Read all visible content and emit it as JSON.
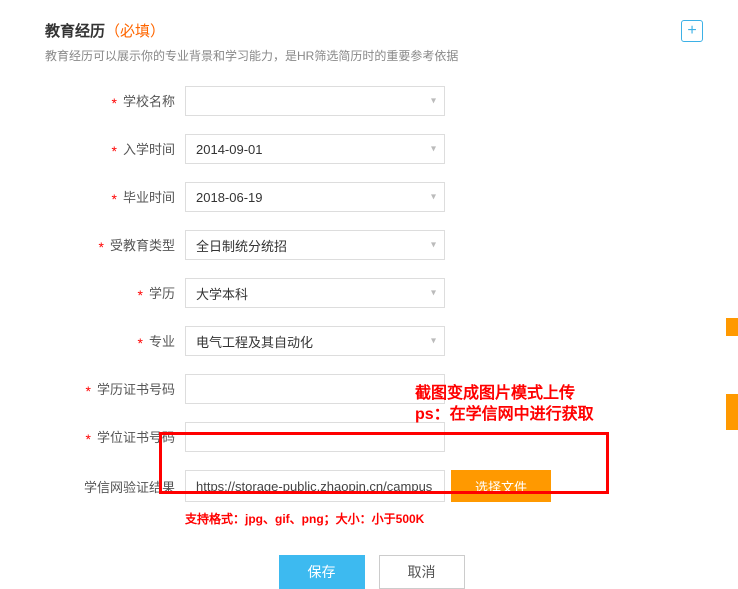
{
  "header": {
    "title": "教育经历",
    "required_tag": "（必填）",
    "subtitle": "教育经历可以展示你的专业背景和学习能力，是HR筛选简历时的重要参考依据",
    "add_label": "+"
  },
  "fields": {
    "school": {
      "label": "学校名称",
      "value": ""
    },
    "enroll": {
      "label": "入学时间",
      "value": "2014-09-01"
    },
    "grad": {
      "label": "毕业时间",
      "value": "2018-06-19"
    },
    "edu_type": {
      "label": "受教育类型",
      "value": "全日制统分统招"
    },
    "degree": {
      "label": "学历",
      "value": "大学本科"
    },
    "major": {
      "label": "专业",
      "value": "电气工程及其自动化"
    },
    "cert_degree": {
      "label": "学历证书号码",
      "value": ""
    },
    "cert_diploma": {
      "label": "学位证书号码",
      "value": ""
    },
    "chsi": {
      "label": "学信网验证结果",
      "value": "https://storage-public.zhaopin.cn/campus",
      "button": "选择文件"
    }
  },
  "hint": "支持格式：jpg、gif、png；大小：小于500K",
  "annotation": {
    "line1": "截图变成图片模式上传",
    "line2": "ps：在学信网中进行获取"
  },
  "actions": {
    "save": "保存",
    "cancel": "取消"
  }
}
